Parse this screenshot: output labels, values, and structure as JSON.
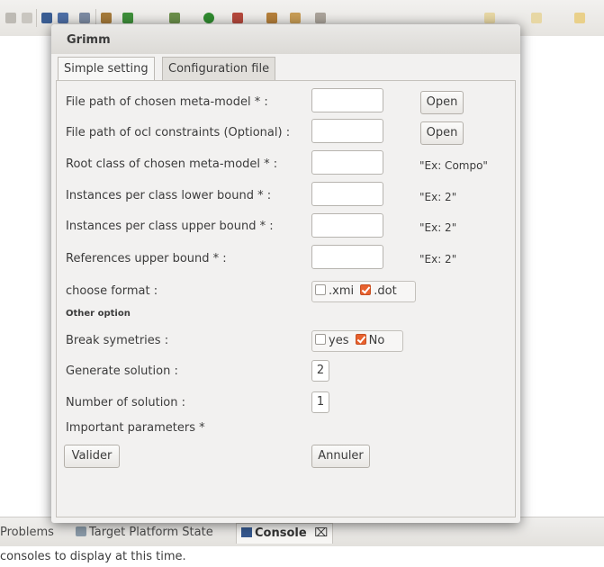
{
  "dialog": {
    "title": "Grimm",
    "tabs": [
      {
        "label": "Simple setting",
        "active": true
      },
      {
        "label": "Configuration file",
        "active": false
      }
    ],
    "rows": [
      {
        "label": "File path of chosen meta-model * :",
        "value": "",
        "button": "Open"
      },
      {
        "label": "File path of ocl constraints (Optional) :",
        "value": "",
        "button": "Open"
      },
      {
        "label": "Root class of chosen meta-model * :",
        "value": "",
        "hint": "\"Ex: Compo\""
      },
      {
        "label": "Instances per class lower bound * :",
        "value": "",
        "hint": "\"Ex: 2\""
      },
      {
        "label": "Instances per class upper bound * :",
        "value": "",
        "hint": "\"Ex: 2\""
      },
      {
        "label": "References upper bound * :",
        "value": "",
        "hint": "\"Ex: 2\""
      }
    ],
    "format": {
      "label": "choose format :",
      "options": [
        {
          "label": ".xmi",
          "checked": false
        },
        {
          "label": ".dot",
          "checked": true
        }
      ]
    },
    "other_option_label": "Other option",
    "symmetries": {
      "label": "Break symetries :",
      "options": [
        {
          "label": "yes",
          "checked": false
        },
        {
          "label": "No",
          "checked": true
        }
      ]
    },
    "generate_solution": {
      "label": "Generate solution :",
      "value": "2"
    },
    "number_of_solution": {
      "label": "Number of solution :",
      "value": "1"
    },
    "important_label": "Important parameters *",
    "validate_button": "Valider",
    "cancel_button": "Annuler"
  },
  "bottom_panel": {
    "tabs": [
      {
        "label": "Problems",
        "icon": "problems-icon"
      },
      {
        "label": "Target Platform State",
        "icon": "target-platform-icon"
      },
      {
        "label": "Console",
        "icon": "console-icon",
        "active": true,
        "close": "⌧"
      }
    ],
    "message": "consoles to display at this time."
  },
  "colors": {
    "accent_check": "#e8612e",
    "dialog_bg": "#f2f1f0"
  }
}
